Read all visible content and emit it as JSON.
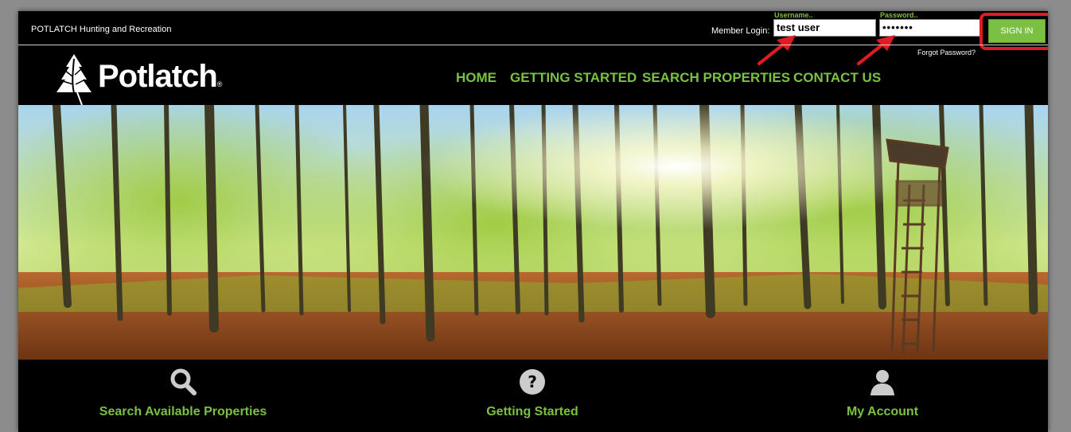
{
  "topbar": {
    "site_title": "POTLATCH Hunting and Recreation",
    "member_login": "Member Login:",
    "username_label": "Username..",
    "username_value": "test user",
    "password_label": "Password..",
    "password_value": "•••••••",
    "signin_label": "SIGN IN",
    "forgot_password": "Forgot Password?"
  },
  "logo": {
    "text": "Potlatch",
    "mark": "®"
  },
  "nav": {
    "home": "HOME",
    "getting_started": "GETTING STARTED",
    "search_properties": "SEARCH PROPERTIES",
    "contact_us": "CONTACT US"
  },
  "features": {
    "search": {
      "label": "Search Available Properties",
      "icon": "search-icon"
    },
    "getting_started": {
      "label": "Getting Started",
      "icon": "question-icon"
    },
    "account": {
      "label": "My Account",
      "icon": "user-icon"
    }
  },
  "colors": {
    "accent_green": "#7cc043",
    "highlight_red": "#e21a22",
    "background": "#000000"
  }
}
